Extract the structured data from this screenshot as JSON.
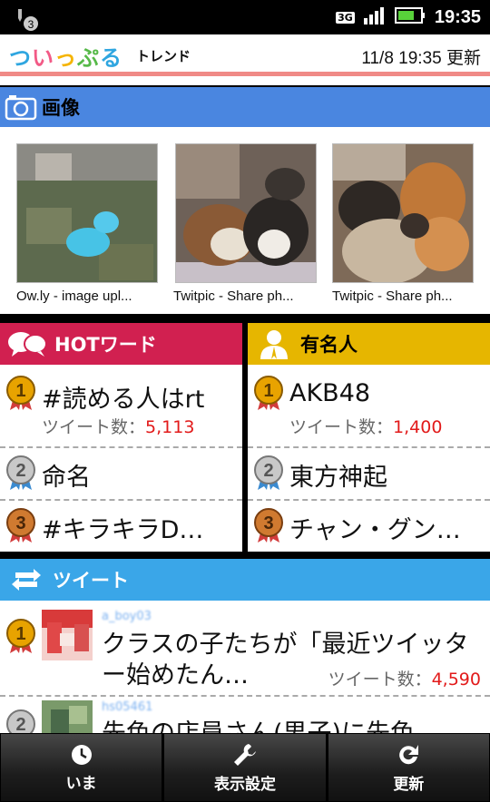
{
  "status_bar": {
    "notification_count": "3",
    "network": "3G",
    "time": "19:35"
  },
  "header": {
    "logo": [
      "つ",
      "い",
      "っ",
      "ぷ",
      "る"
    ],
    "subtitle": "トレンド",
    "updated": "11/8 19:35 更新"
  },
  "images": {
    "title": "画像",
    "items": [
      {
        "caption": "Ow.ly - image upl..."
      },
      {
        "caption": "Twitpic - Share ph..."
      },
      {
        "caption": "Twitpic - Share ph..."
      }
    ]
  },
  "hot_words": {
    "title": "HOTワード",
    "count_label": "ツイート数：",
    "items": [
      {
        "rank": "1",
        "word": "#読める人はrt",
        "count": "5,113"
      },
      {
        "rank": "2",
        "word": "命名"
      },
      {
        "rank": "3",
        "word": "#キラキラD…"
      }
    ]
  },
  "famous": {
    "title": "有名人",
    "count_label": "ツイート数：",
    "items": [
      {
        "rank": "1",
        "word": "AKB48",
        "count": "1,400"
      },
      {
        "rank": "2",
        "word": "東方神起"
      },
      {
        "rank": "3",
        "word": "チャン・グン…"
      }
    ]
  },
  "tweets": {
    "title": "ツイート",
    "count_label": "ツイート数：",
    "items": [
      {
        "rank": "1",
        "user": "a_boy03",
        "text": "クラスの子たちが「最近ツイッター始めたん…",
        "count": "4,590"
      },
      {
        "rank": "2",
        "user": "hs05461",
        "text": "先色の店員さん(男子)に先色…"
      }
    ]
  },
  "bottom_bar": [
    {
      "label": "いま",
      "icon": "clock-icon"
    },
    {
      "label": "表示設定",
      "icon": "wrench-icon"
    },
    {
      "label": "更新",
      "icon": "refresh-icon"
    }
  ],
  "colors": {
    "images_header": "#4a86e0",
    "hot_header": "#d12050",
    "famous_header": "#e6b600",
    "tweet_header": "#3aa6e8",
    "count_number": "#e21a1a",
    "header_rule": "#f08a86"
  }
}
